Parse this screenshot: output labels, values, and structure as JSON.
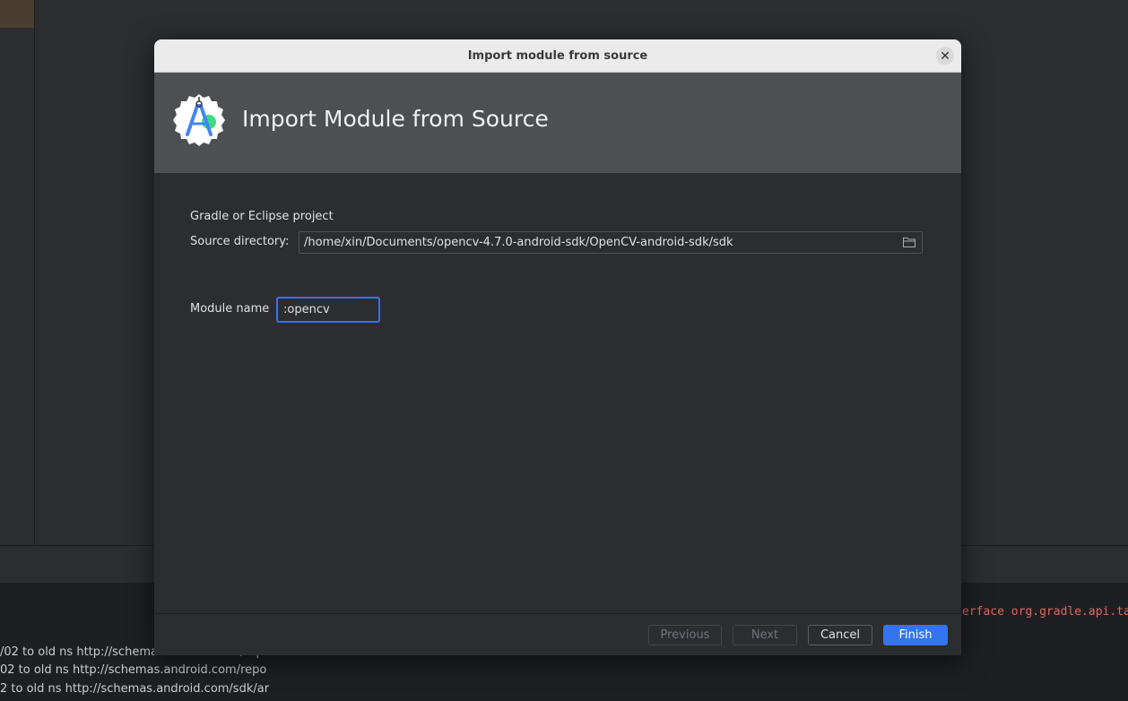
{
  "console": {
    "lines": [
      "/02 to old ns http://schemas.android.com/rep",
      "02 to old ns http://schemas.android.com/repo",
      "2 to old ns http://schemas.android.com/sdk/ar"
    ],
    "right_fragment": "erface org.gradle.api.ta"
  },
  "dialog": {
    "window_title": "Import module from source",
    "close_icon": "close-icon",
    "header_title": "Import Module from Source",
    "logo_icon": "android-studio-logo-icon",
    "section_label": "Gradle or Eclipse project",
    "source_directory_label": "Source directory:",
    "source_directory_value": "/home/xin/Documents/opencv-4.7.0-android-sdk/OpenCV-android-sdk/sdk",
    "browse_icon": "folder-icon",
    "module_name_label": "Module name",
    "module_name_value": ":opencv",
    "buttons": {
      "previous": "Previous",
      "next": "Next",
      "cancel": "Cancel",
      "finish": "Finish"
    }
  },
  "colors": {
    "accent": "#3574f0",
    "background": "#2b2d30",
    "header": "#4e4f52",
    "error_text": "#e0675f"
  }
}
